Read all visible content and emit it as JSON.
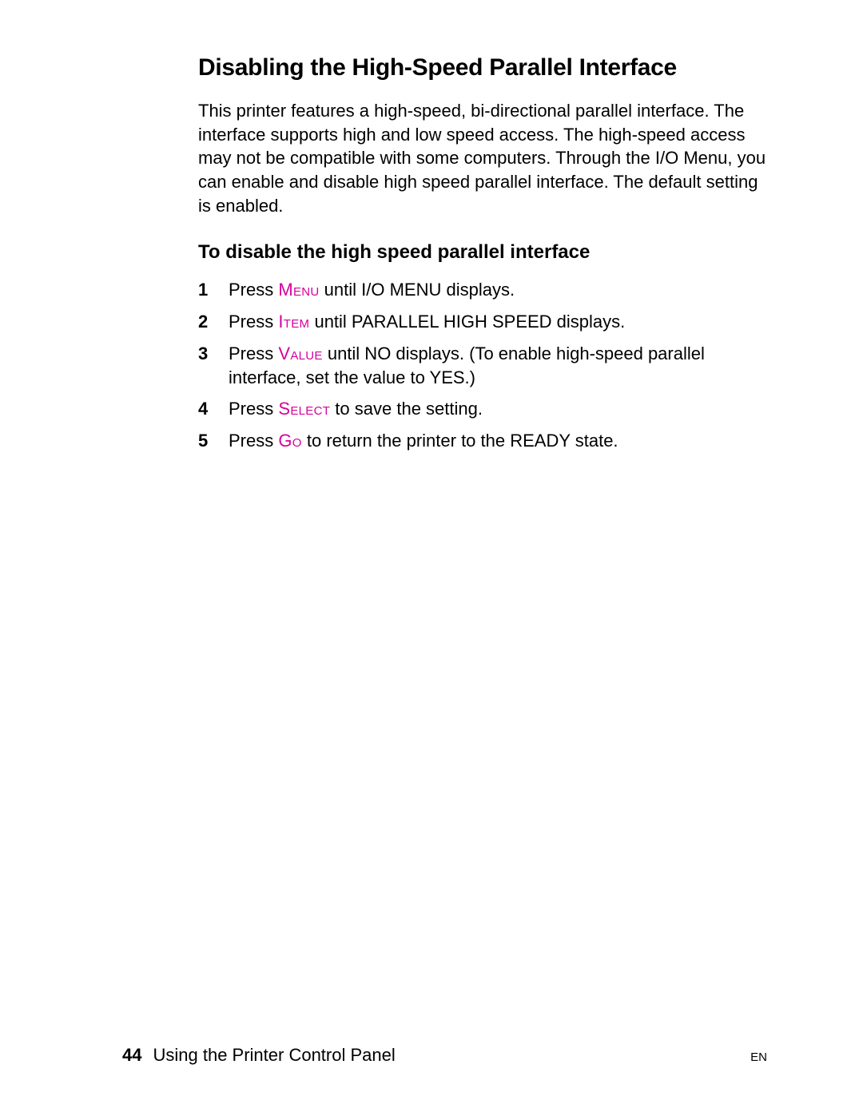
{
  "heading": "Disabling the High-Speed Parallel Interface",
  "intro": "This printer features a high-speed, bi-directional parallel interface. The interface supports high and low speed access. The high-speed access may not be compatible with some computers. Through the I/O Menu, you can enable and disable high speed parallel interface. The default setting is enabled.",
  "subheading": "To disable the high speed parallel interface",
  "steps": [
    {
      "num": "1",
      "pre": "Press ",
      "key": "Menu",
      "post": " until I/O MENU displays."
    },
    {
      "num": "2",
      "pre": "Press ",
      "key": "Item",
      "post": " until PARALLEL HIGH SPEED displays."
    },
    {
      "num": "3",
      "pre": "Press ",
      "key": "Value",
      "post": " until NO displays. (To enable high-speed parallel interface, set the value to YES.)"
    },
    {
      "num": "4",
      "pre": "Press ",
      "key": "Select",
      "post": " to save the setting."
    },
    {
      "num": "5",
      "pre": "Press ",
      "key": "Go",
      "post": " to return the printer to the READY state."
    }
  ],
  "footer": {
    "page": "44",
    "section": "Using the Printer Control Panel",
    "lang": "EN"
  }
}
